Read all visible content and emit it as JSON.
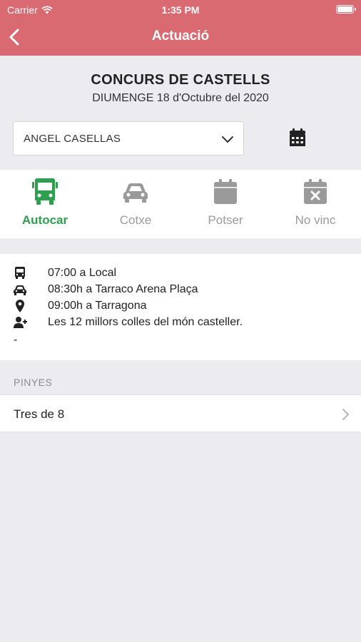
{
  "status_bar": {
    "carrier": "Carrier",
    "time": "1:35 PM"
  },
  "nav": {
    "title": "Actuació"
  },
  "event": {
    "title": "CONCURS DE CASTELLS",
    "date": "DIUMENGE 18 d'Octubre del 2020"
  },
  "member_select": {
    "value": "ANGEL CASELLAS"
  },
  "options": [
    {
      "label": "Autocar",
      "icon": "bus-icon",
      "active": true
    },
    {
      "label": "Cotxe",
      "icon": "car-icon",
      "active": false
    },
    {
      "label": "Potser",
      "icon": "calendar-icon",
      "active": false
    },
    {
      "label": "No vinc",
      "icon": "calendar-x-icon",
      "active": false
    }
  ],
  "details": [
    {
      "icon": "bus-icon",
      "text": "07:00 a Local"
    },
    {
      "icon": "car-icon",
      "text": "08:30h a Tarraco Arena Plaça"
    },
    {
      "icon": "map-pin-icon",
      "text": "09:00h a Tarragona"
    },
    {
      "icon": "user-plus-icon",
      "text": "Les 12 millors colles del món casteller."
    }
  ],
  "details_extra": "-",
  "pinyes": {
    "header": "PINYES",
    "items": [
      {
        "label": "Tres de 8"
      }
    ]
  },
  "colors": {
    "header": "#d96a72",
    "active": "#2e9e4f",
    "inactive": "#9a9a9a",
    "background": "#ebebf0"
  }
}
